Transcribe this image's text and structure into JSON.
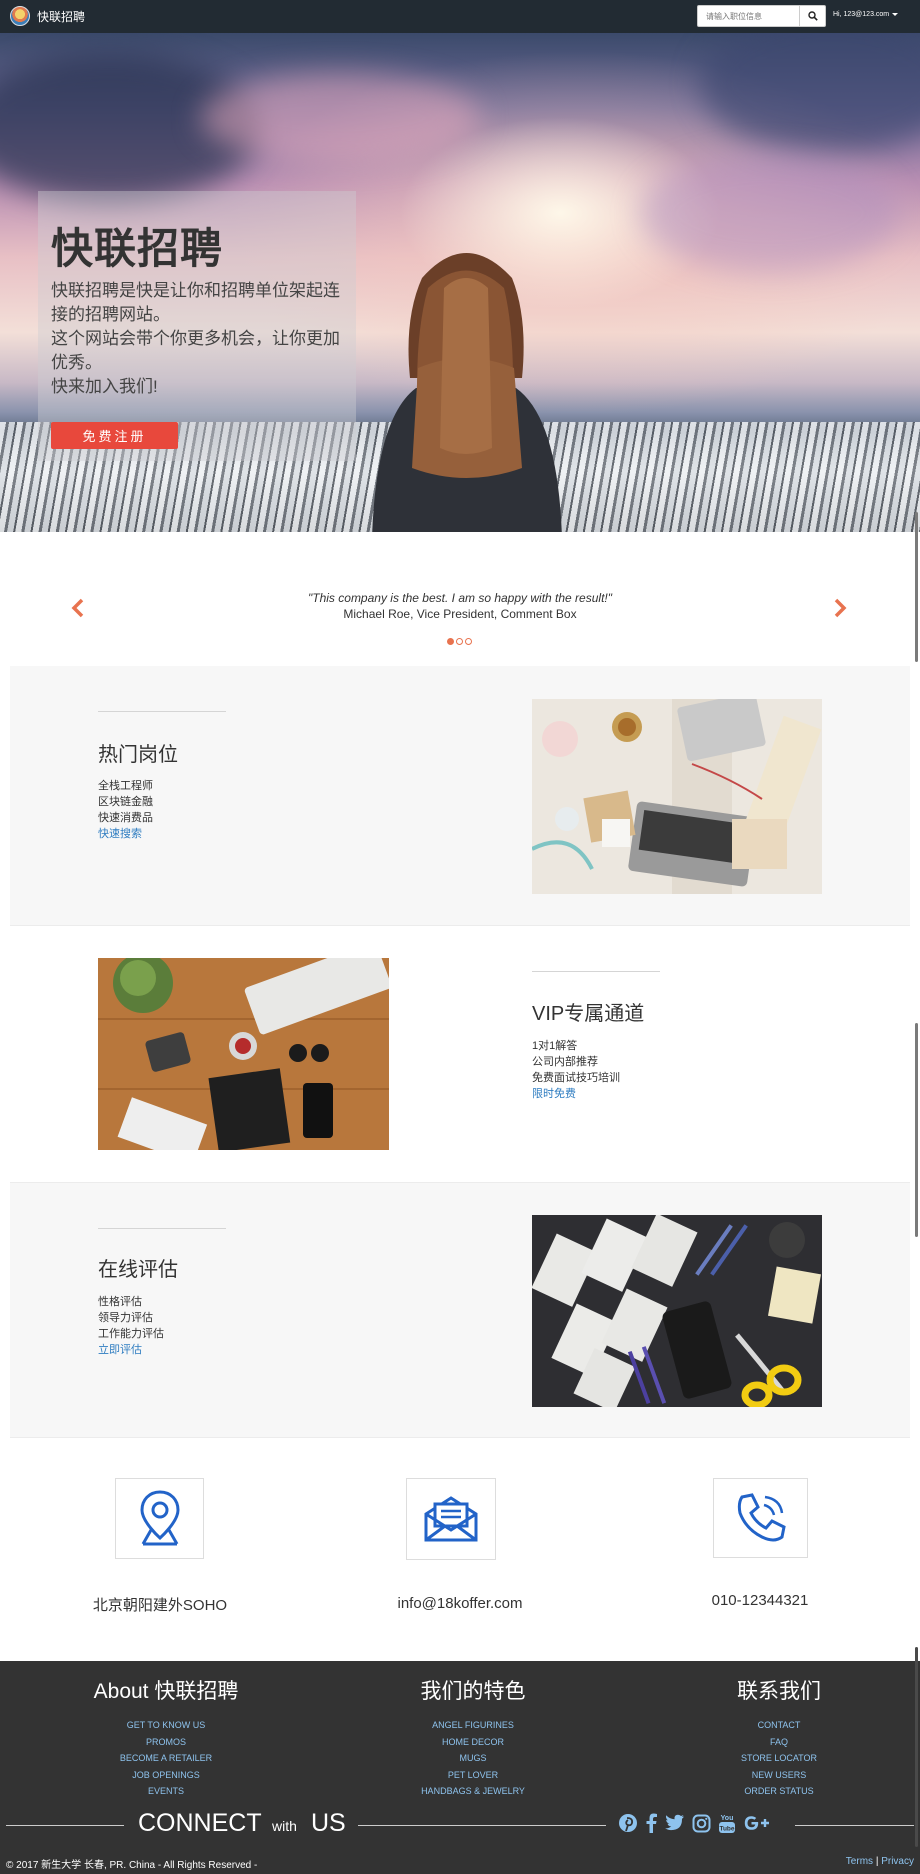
{
  "navbar": {
    "brand": "快联招聘",
    "search_placeholder": "请输入职位信息",
    "user": "Hi, 123@123.com"
  },
  "hero": {
    "title": "快联招聘",
    "lines": [
      "快联招聘是快是让你和招聘单位架起连接的招聘网站。",
      "这个网站会带个你更多机会，让你更加优秀。",
      "快来加入我们!"
    ],
    "cta": "免费注册"
  },
  "testimonial": {
    "quote": "\"This company is the best. I am so happy with the result!\"",
    "author": "Michael Roe, Vice President, Comment Box",
    "slide_count": 3,
    "active_slide": 1
  },
  "features": [
    {
      "title": "热门岗位",
      "items": [
        "全栈工程师",
        "区块链金融",
        "快速消费品"
      ],
      "link": "快速搜索"
    },
    {
      "title": "VIP专属通道",
      "items": [
        "1对1解答",
        "公司内部推荐",
        "免费面试技巧培训"
      ],
      "link": "限时免费"
    },
    {
      "title": "在线评估",
      "items": [
        "性格评估",
        "领导力评估",
        "工作能力评估"
      ],
      "link": "立即评估"
    }
  ],
  "contact": {
    "address": "北京朝阳建外SOHO",
    "email": "info@18koffer.com",
    "phone": "010-12344321"
  },
  "footer": {
    "col1": {
      "title": "About 快联招聘",
      "links": [
        "GET TO KNOW US",
        "PROMOS",
        "BECOME A RETAILER",
        "JOB OPENINGS",
        "EVENTS"
      ]
    },
    "col2": {
      "title": "我们的特色",
      "links": [
        "ANGEL FIGURINES",
        "HOME DECOR",
        "MUGS",
        "PET LOVER",
        "HANDBAGS & JEWELRY"
      ]
    },
    "col3": {
      "title": "联系我们",
      "links": [
        "CONTACT",
        "FAQ",
        "STORE LOCATOR",
        "NEW USERS",
        "ORDER STATUS"
      ]
    },
    "connect": {
      "word1": "CONNECT",
      "word2": "with",
      "word3": "US"
    },
    "social_icons": [
      "pinterest-icon",
      "facebook-icon",
      "twitter-icon",
      "instagram-icon",
      "youtube-icon",
      "google-plus-icon"
    ],
    "copyright": "© 2017 新生大学 长春, PR. China - All Rights Reserved -",
    "terms": "Terms",
    "separator": "|",
    "privacy": "Privacy"
  },
  "colors": {
    "navbar": "#222b33",
    "cta": "#e8483c",
    "link": "#2f7dc1",
    "footer": "#333333",
    "footer_link": "#8ec3ee",
    "arrow": "#e8734f"
  }
}
